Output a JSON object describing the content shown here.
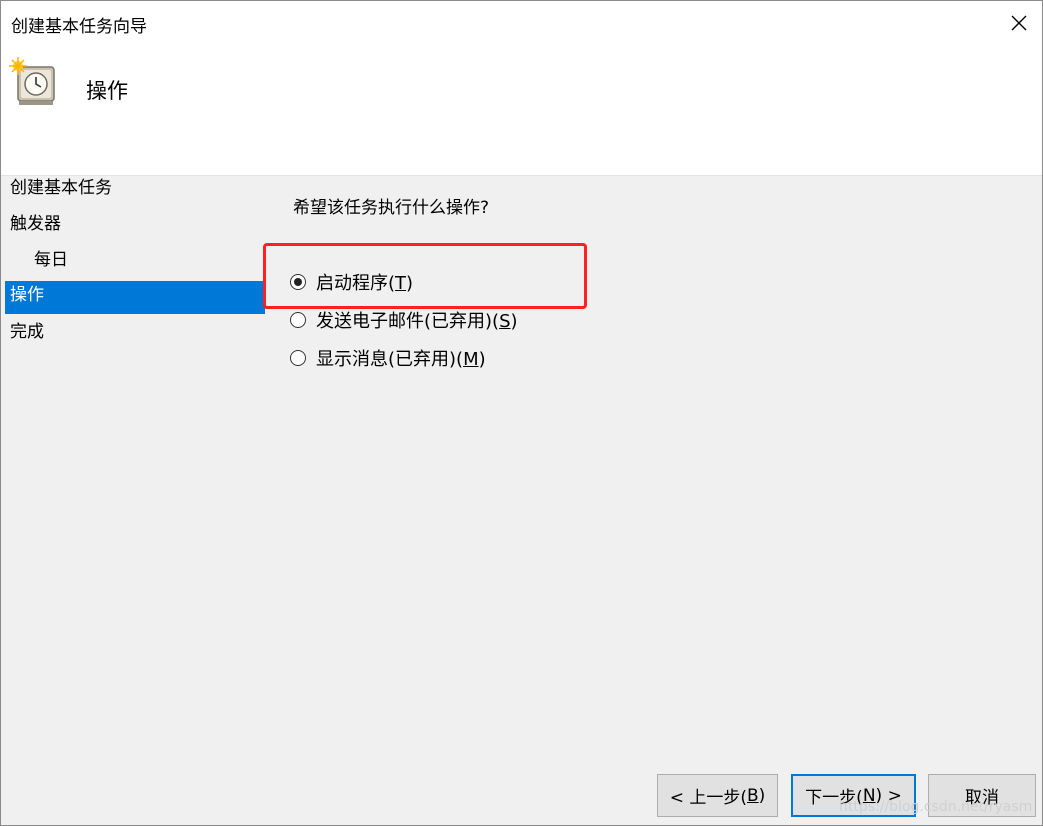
{
  "window": {
    "title": "创建基本任务向导"
  },
  "header": {
    "title": "操作",
    "icon": "task-scheduler-clock-icon"
  },
  "sidebar": {
    "items": [
      {
        "label": "创建基本任务",
        "active": false,
        "indent": false
      },
      {
        "label": "触发器",
        "active": false,
        "indent": false
      },
      {
        "label": "每日",
        "active": false,
        "indent": true
      },
      {
        "label": "操作",
        "active": true,
        "indent": false
      },
      {
        "label": "完成",
        "active": false,
        "indent": false
      }
    ]
  },
  "content": {
    "question": "希望该任务执行什么操作?",
    "options": [
      {
        "label": "启动程序(",
        "key": "T",
        "suffix": ")",
        "checked": true
      },
      {
        "label": "发送电子邮件(已弃用)(",
        "key": "S",
        "suffix": ")",
        "checked": false
      },
      {
        "label": "显示消息(已弃用)(",
        "key": "M",
        "suffix": ")",
        "checked": false
      }
    ]
  },
  "buttons": {
    "back": {
      "prefix": "< 上一步(",
      "key": "B",
      "suffix": ")"
    },
    "next": {
      "prefix": "下一步(",
      "key": "N",
      "suffix": ") >"
    },
    "cancel": "取消"
  },
  "watermark": "https://blog.csdn.net/ryasm",
  "colors": {
    "accent": "#0078d7",
    "highlight": "#ff2020",
    "background": "#f0f0f0"
  }
}
